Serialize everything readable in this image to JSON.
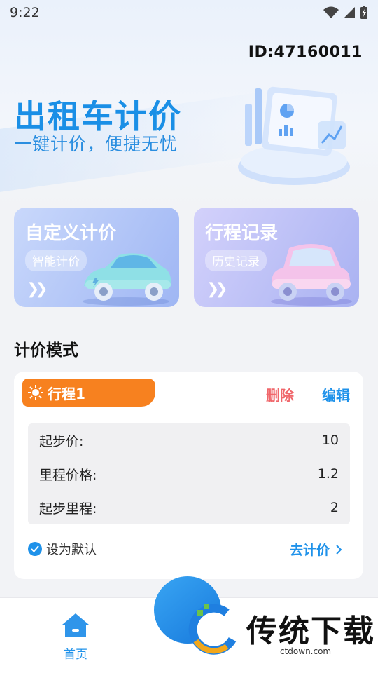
{
  "status_bar": {
    "time": "9:22"
  },
  "user": {
    "id_label": "ID:47160011"
  },
  "hero": {
    "title": "出租车计价",
    "subtitle": "一键计价，便捷无忧"
  },
  "cards": [
    {
      "title": "自定义计价",
      "tag": "智能计价"
    },
    {
      "title": "行程记录",
      "tag": "历史记录"
    }
  ],
  "section": {
    "title": "计价模式"
  },
  "pricing_mode": {
    "name": "行程1",
    "delete_label": "删除",
    "edit_label": "编辑",
    "rows": [
      {
        "label": "起步价:",
        "value": "10"
      },
      {
        "label": "里程价格:",
        "value": "1.2"
      },
      {
        "label": "起步里程:",
        "value": "2"
      }
    ],
    "default_label": "设为默认",
    "go_label": "去计价"
  },
  "tabbar": {
    "home_label": "首页"
  },
  "watermark": {
    "text": "传统下载",
    "url": "ctdown.com"
  },
  "colors": {
    "accent": "#1f92ea",
    "tag_orange": "#f7811f",
    "delete_red": "#f0676b"
  }
}
